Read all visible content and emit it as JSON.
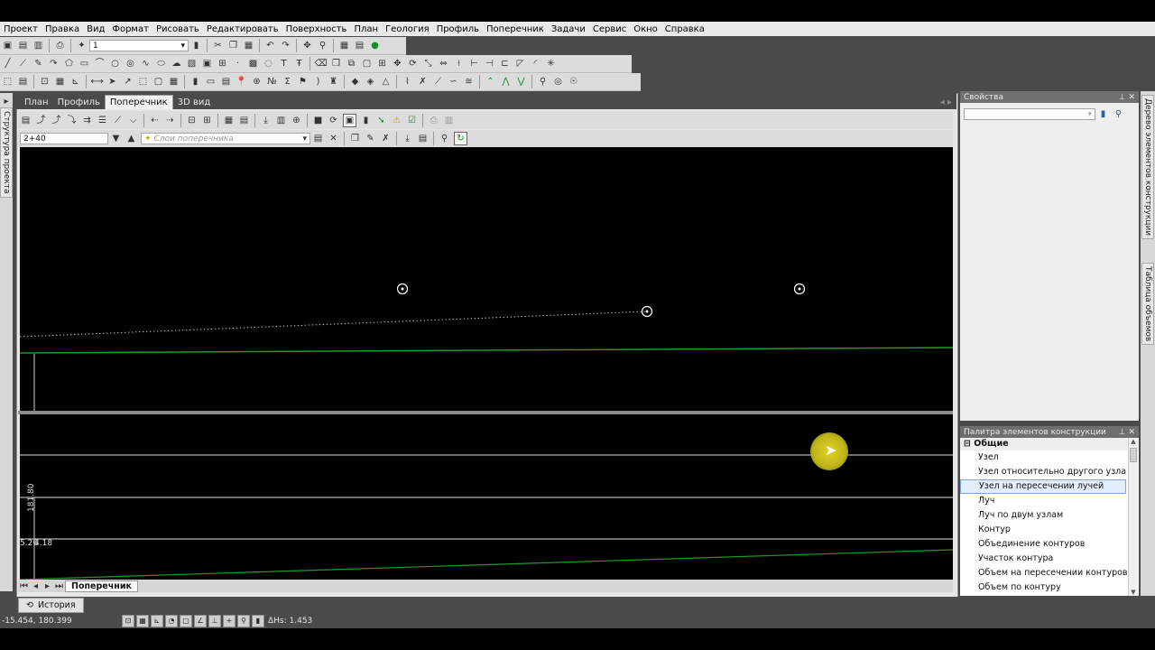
{
  "menu": [
    "Проект",
    "Правка",
    "Вид",
    "Формат",
    "Рисовать",
    "Редактировать",
    "Поверхность",
    "План",
    "Геология",
    "Профиль",
    "Поперечник",
    "Задачи",
    "Сервис",
    "Окно",
    "Справка"
  ],
  "toolbar": {
    "layer_value": "1"
  },
  "left_tabs": [
    "Структура проекта"
  ],
  "doc_tabs": [
    {
      "label": "План",
      "active": false
    },
    {
      "label": "Профиль",
      "active": false
    },
    {
      "label": "Поперечник",
      "active": true
    },
    {
      "label": "3D вид",
      "active": false
    }
  ],
  "section": {
    "station": "2+40",
    "layers_placeholder": "Слои поперечника"
  },
  "view": {
    "label_vertical": "181.80",
    "label_left": "5.26",
    "label_right": "4.18"
  },
  "sheet_tab": "Поперечник",
  "properties_panel": {
    "title": "Свойства"
  },
  "palette": {
    "title": "Палитра элементов конструкции",
    "group": "Общие",
    "items": [
      "Узел",
      "Узел относительно другого узла",
      "Узел на пересечении лучей",
      "Луч",
      "Луч по двум узлам",
      "Контур",
      "Объединение контуров",
      "Участок контура",
      "Объем на пересечении контуров",
      "Объем по контуру"
    ],
    "selected_index": 2
  },
  "right_tabs": [
    "Дерево элементов конструкции",
    "Таблица объемов"
  ],
  "history_tab": "История",
  "status": {
    "coords": "-15.454, 180.399",
    "dh": "ΔНs: 1.453"
  },
  "colors": {
    "ground_line": "#1f9a2a",
    "selection": "#7da7d9",
    "cursor_highlight": "#d8d020"
  }
}
